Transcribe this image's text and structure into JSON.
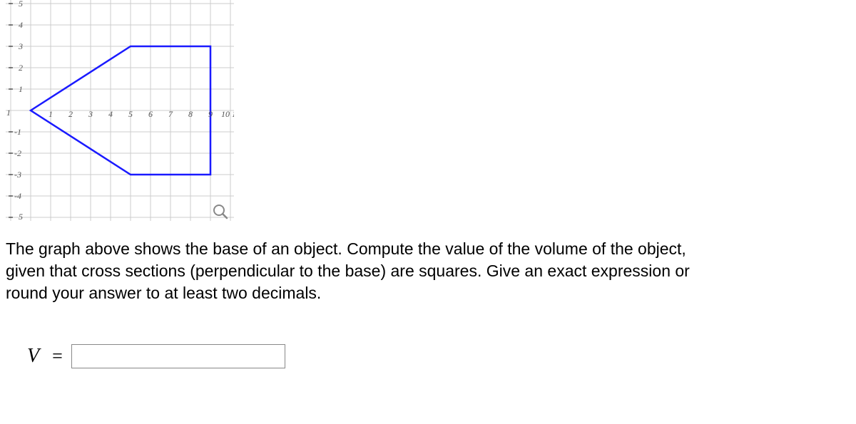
{
  "chart_data": {
    "type": "line",
    "title": "",
    "xlabel": "",
    "ylabel": "",
    "xlim": [
      -1,
      11
    ],
    "ylim": [
      -5,
      5
    ],
    "x_ticks": [
      "1",
      "2",
      "3",
      "4",
      "5",
      "6",
      "7",
      "8",
      "9",
      "10",
      "1"
    ],
    "y_ticks_pos": [
      "5",
      "4",
      "3",
      "2",
      "1"
    ],
    "y_ticks_neg": [
      "-1",
      "-2",
      "-3",
      "-4",
      "5"
    ],
    "shape_vertices": [
      [
        0,
        0
      ],
      [
        5,
        3
      ],
      [
        9,
        3
      ],
      [
        9,
        -3
      ],
      [
        5,
        -3
      ],
      [
        0,
        0
      ]
    ]
  },
  "problem": {
    "text": "The graph above shows the base of an object. Compute the value of the volume of the object, given that cross sections (perpendicular to the base) are squares. Give an exact expression or round your answer to at least two decimals."
  },
  "answer": {
    "label": "V",
    "equals": "=",
    "value": ""
  },
  "y_axis_origin_label": "1"
}
